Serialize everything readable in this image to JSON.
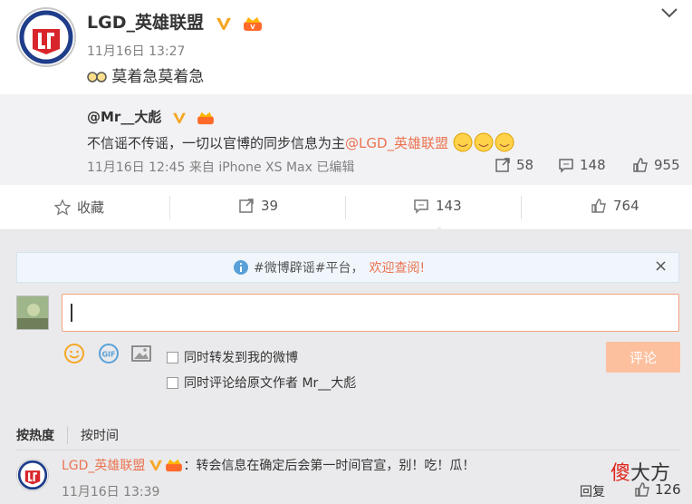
{
  "post": {
    "author": "LGD_英雄联盟",
    "time": "11月16日 13:27",
    "text": "莫着急莫着急"
  },
  "quote": {
    "author": "@Mr__大彪",
    "text": "不信谣不传谣，一切以官博的同步信息为主",
    "mention": "@LGD_英雄联盟",
    "meta": "11月16日 12:45 来自 iPhone XS Max  已编辑",
    "reposts": "58",
    "comments": "148",
    "likes": "955"
  },
  "actions": {
    "favorite": "收藏",
    "repost": "39",
    "comment": "143",
    "like": "764"
  },
  "comment_panel": {
    "notice_tag": "#微博辟谣#平台，",
    "notice_link": "欢迎查阅!",
    "close": "×",
    "input_value": "",
    "checkbox_repost": "同时转发到我的微博",
    "checkbox_author": "同时评论给原文作者 Mr__大彪",
    "submit": "评论"
  },
  "sort": {
    "hot": "按热度",
    "time": "按时间"
  },
  "comments": [
    {
      "author": "LGD_英雄联盟",
      "text": "：转会信息在确定后会第一时间官宣，别！吃！瓜！",
      "time": "11月16日 13:39",
      "reply": "回复",
      "likes": "126"
    }
  ],
  "watermark": {
    "part1": "傻",
    "part2": "大方"
  },
  "colors": {
    "accent": "#eb7350",
    "vip": "#f5a623",
    "brand_red": "#d8262c",
    "brand_blue": "#1f3d8a"
  }
}
